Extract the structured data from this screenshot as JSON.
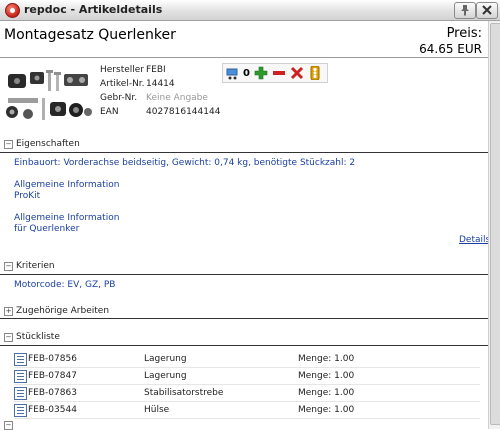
{
  "window": {
    "title": "repdoc - Artikeldetails"
  },
  "product": {
    "title": "Montagesatz Querlenker",
    "price_label": "Preis:",
    "price_value": "64.65 EUR",
    "info": [
      {
        "label": "Hersteller",
        "value": "FEBI"
      },
      {
        "label": "Artikel-Nr.",
        "value": "14414"
      },
      {
        "label": "Gebr-Nr.",
        "value": "Keine Angabe"
      },
      {
        "label": "EAN",
        "value": "4027816144144"
      }
    ]
  },
  "actions": {
    "quantity": "0"
  },
  "sections": {
    "eigenschaften": {
      "label": "Eigenschaften",
      "text": "Einbauort: Vorderachse beidseitig, Gewicht: 0,74 kg, benötigte Stückzahl: 2",
      "links": [
        {
          "line1": "Allgemeine Information",
          "line2": "ProKit"
        },
        {
          "line1": "Allgemeine Information",
          "line2": "für Querlenker"
        }
      ],
      "details": "Details"
    },
    "kriterien": {
      "label": "Kriterien",
      "text": "Motorcode: EV, GZ, PB"
    },
    "arbeiten": {
      "label": "Zugehörige Arbeiten"
    },
    "stueckliste": {
      "label": "Stückliste",
      "rows": [
        {
          "article": "FEB-07856",
          "name": "Lagerung",
          "qty": "Menge: 1.00"
        },
        {
          "article": "FEB-07847",
          "name": "Lagerung",
          "qty": "Menge: 1.00"
        },
        {
          "article": "FEB-07863",
          "name": "Stabilisatorstrebe",
          "qty": "Menge: 1.00"
        },
        {
          "article": "FEB-03544",
          "name": "Hülse",
          "qty": "Menge: 1.00"
        }
      ]
    }
  },
  "colors": {
    "link": "#1a3fa0",
    "add": "#2e9a2e",
    "remove": "#cc2222"
  },
  "icons": [
    "app-icon",
    "pin-icon",
    "close-icon",
    "cart-icon",
    "plus-icon",
    "minus-icon",
    "delete-icon",
    "traffic-light-icon",
    "document-icon"
  ]
}
